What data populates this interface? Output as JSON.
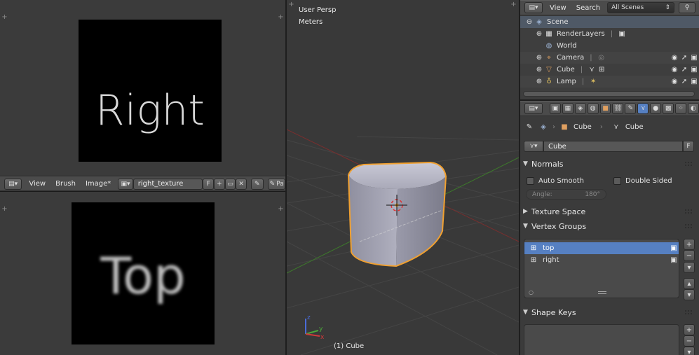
{
  "image_editor_top": {
    "canvas_text": "Right"
  },
  "image_editor_header": {
    "editor_type_icon": "image-editor-icon",
    "menus": [
      "View",
      "Brush",
      "Image*"
    ],
    "image_name": "right_texture",
    "fake_user_label": "F",
    "overflow_label": "Pa"
  },
  "image_editor_bottom": {
    "canvas_text": "Top"
  },
  "viewport": {
    "view_name": "User Persp",
    "units": "Meters",
    "object_label": "(1) Cube",
    "axis_labels": [
      "z",
      "y",
      "x"
    ]
  },
  "outliner_header": {
    "view_label": "View",
    "search_label": "Search",
    "scope": "All Scenes"
  },
  "outliner": {
    "rows": [
      {
        "label": "Scene",
        "icon": "scene-icon"
      },
      {
        "label": "RenderLayers",
        "icon": "render-layers-icon"
      },
      {
        "label": "World",
        "icon": "world-icon"
      },
      {
        "label": "Camera",
        "icon": "camera-icon"
      },
      {
        "label": "Cube",
        "icon": "mesh-icon"
      },
      {
        "label": "Lamp",
        "icon": "lamp-icon"
      }
    ]
  },
  "properties": {
    "breadcrumb": [
      "Cube",
      "Cube"
    ],
    "mesh_name": "Cube",
    "fake_user_label": "F",
    "normals": {
      "title": "Normals",
      "auto_smooth": "Auto Smooth",
      "double_sided": "Double Sided",
      "angle_label": "Angle:",
      "angle_value": "180°"
    },
    "texture_space_title": "Texture Space",
    "vertex_groups": {
      "title": "Vertex Groups",
      "items": [
        "top",
        "right"
      ]
    },
    "shape_keys_title": "Shape Keys"
  },
  "colors": {
    "accent_select": "#5680c2",
    "cube_outline": "#f0a030"
  }
}
